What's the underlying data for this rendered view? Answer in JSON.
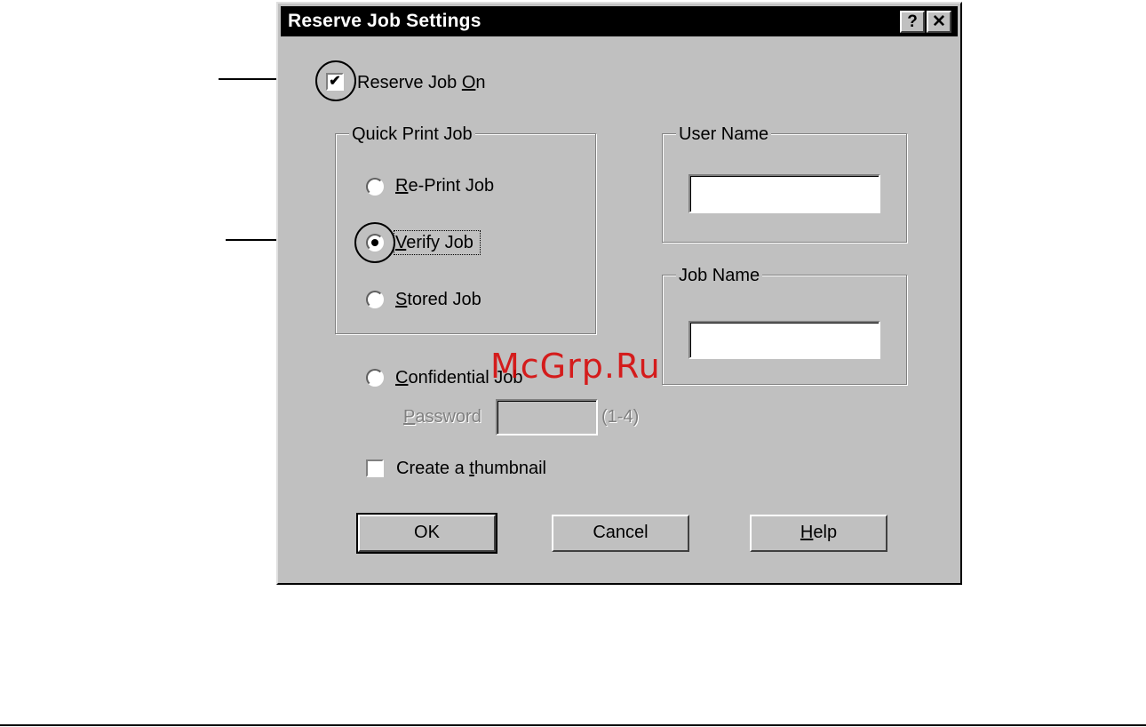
{
  "window": {
    "title": "Reserve Job Settings",
    "help_button": "?",
    "close_button": "✕"
  },
  "reserve_job_on": {
    "label_pre": "Reserve Job ",
    "label_accel": "O",
    "label_post": "n",
    "checked": true
  },
  "quick_print_group": {
    "title": "Quick Print Job",
    "options": [
      {
        "accel": "R",
        "rest": "e-Print Job",
        "selected": false
      },
      {
        "accel": "V",
        "rest": "erify Job",
        "selected": true
      },
      {
        "accel": "S",
        "rest": "tored Job",
        "selected": false
      }
    ]
  },
  "confidential_job": {
    "accel": "C",
    "rest": "onfidential Job",
    "selected": false
  },
  "password": {
    "accel": "P",
    "rest": "assword",
    "value": "",
    "hint": "(1-4)"
  },
  "user_name": {
    "title": "User Name",
    "value": ""
  },
  "job_name": {
    "title": "Job Name",
    "value": ""
  },
  "create_thumbnail": {
    "pre": "Create a ",
    "accel": "t",
    "rest": "humbnail",
    "checked": false
  },
  "buttons": {
    "ok": "OK",
    "cancel": "Cancel",
    "help_accel": "H",
    "help_rest": "elp"
  },
  "watermark": "McGrp.Ru"
}
